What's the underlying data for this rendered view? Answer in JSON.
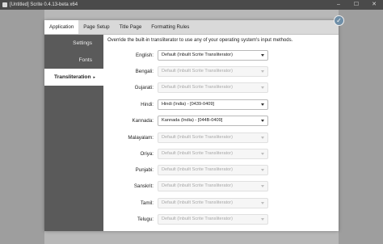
{
  "window": {
    "title": "[Untitled] Scrite 0.4.13-beta x64",
    "minimize": "–",
    "maximize": "☐",
    "close": "✕"
  },
  "confirm": {
    "icon": "✓"
  },
  "tabs": [
    {
      "label": "Application",
      "active": true
    },
    {
      "label": "Page Setup",
      "active": false
    },
    {
      "label": "Title Page",
      "active": false
    },
    {
      "label": "Formatting Rules",
      "active": false
    }
  ],
  "sidebar": {
    "items": [
      {
        "label": "Settings",
        "active": false
      },
      {
        "label": "Fonts",
        "active": false
      },
      {
        "label": "Transliteration",
        "active": true,
        "arrow": "▸"
      }
    ]
  },
  "transliteration": {
    "intro": "Override the built-in transliterator to use any of your operating system's input methods.",
    "languages": [
      {
        "label": "English:",
        "value": "Default (Inbuilt Scrite Transliterator)",
        "enabled": true
      },
      {
        "label": "Bengali:",
        "value": "Default (Inbuilt Scrite Transliterator)",
        "enabled": false
      },
      {
        "label": "Gujarati:",
        "value": "Default (Inbuilt Scrite Transliterator)",
        "enabled": false
      },
      {
        "label": "Hindi:",
        "value": "Hindi (India) - [0439-0409]",
        "enabled": true
      },
      {
        "label": "Kannada:",
        "value": "Kannada (India) - [044B-0409]",
        "enabled": true
      },
      {
        "label": "Malayalam:",
        "value": "Default (Inbuilt Scrite Transliterator)",
        "enabled": false
      },
      {
        "label": "Oriya:",
        "value": "Default (Inbuilt Scrite Transliterator)",
        "enabled": false
      },
      {
        "label": "Punjabi:",
        "value": "Default (Inbuilt Scrite Transliterator)",
        "enabled": false
      },
      {
        "label": "Sanskrit:",
        "value": "Default (Inbuilt Scrite Transliterator)",
        "enabled": false
      },
      {
        "label": "Tamil:",
        "value": "Default (Inbuilt Scrite Transliterator)",
        "enabled": false
      },
      {
        "label": "Telugu:",
        "value": "Default (Inbuilt Scrite Transliterator)",
        "enabled": false
      }
    ]
  }
}
